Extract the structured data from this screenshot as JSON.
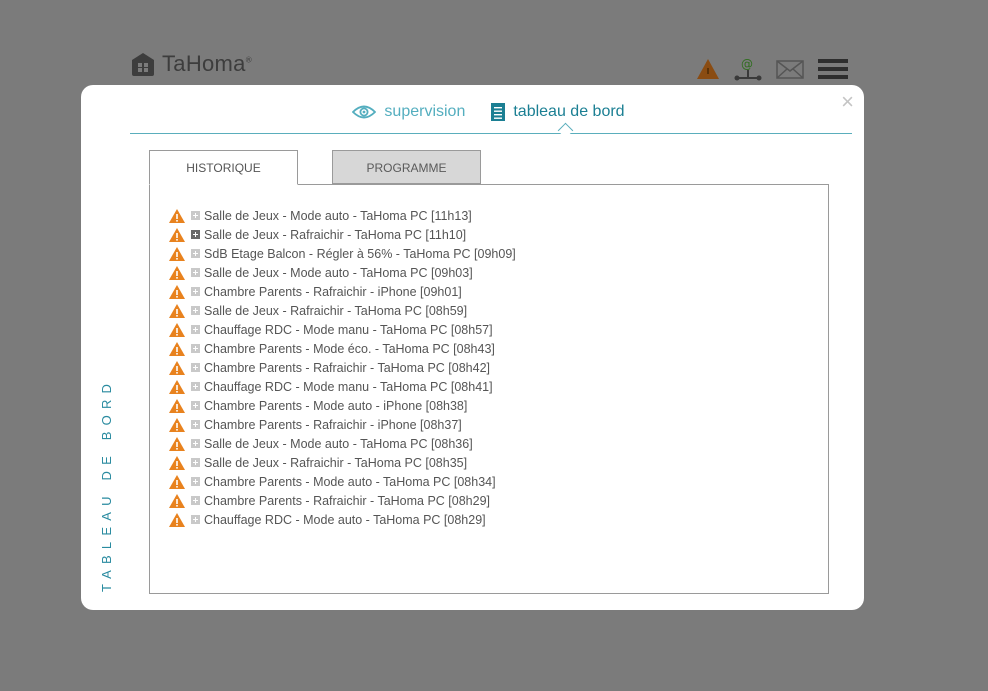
{
  "header": {
    "logo_text": "TaHoma",
    "logo_mark": "®",
    "icons": [
      "warning-icon",
      "network-icon",
      "mail-icon",
      "menu-icon"
    ]
  },
  "modal": {
    "close_label": "×",
    "nav": {
      "supervision": "supervision",
      "dashboard": "tableau de bord"
    },
    "side_label": "TABLEAU DE BORD",
    "tabs": {
      "history": "HISTORIQUE",
      "program": "PROGRAMME"
    },
    "history": [
      {
        "text": "Salle de Jeux - Mode auto - TaHoma PC  [11h13]"
      },
      {
        "text": "Salle de Jeux - Rafraichir - TaHoma PC  [11h10]"
      },
      {
        "text": "SdB Etage Balcon - Régler à 56% - TaHoma PC  [09h09]"
      },
      {
        "text": "Salle de Jeux - Mode auto - TaHoma PC  [09h03]"
      },
      {
        "text": "Chambre Parents - Rafraichir - iPhone  [09h01]"
      },
      {
        "text": "Salle de Jeux - Rafraichir - TaHoma PC  [08h59]"
      },
      {
        "text": "Chauffage RDC - Mode manu - TaHoma PC  [08h57]"
      },
      {
        "text": "Chambre Parents - Mode éco. - TaHoma PC  [08h43]"
      },
      {
        "text": "Chambre Parents - Rafraichir - TaHoma PC  [08h42]"
      },
      {
        "text": "Chauffage RDC - Mode manu - TaHoma PC  [08h41]"
      },
      {
        "text": "Chambre Parents - Mode auto - iPhone  [08h38]"
      },
      {
        "text": "Chambre Parents - Rafraichir - iPhone  [08h37]"
      },
      {
        "text": "Salle de Jeux - Mode auto - TaHoma PC  [08h36]"
      },
      {
        "text": "Salle de Jeux - Rafraichir - TaHoma PC  [08h35]"
      },
      {
        "text": "Chambre Parents - Mode auto - TaHoma PC  [08h34]"
      },
      {
        "text": "Chambre Parents - Rafraichir - TaHoma PC  [08h29]"
      },
      {
        "text": "Chauffage RDC - Mode auto - TaHoma PC  [08h29]"
      }
    ]
  },
  "colors": {
    "accent": "#1b7f93",
    "warning": "#e8821e",
    "overlay": "#7b7b7b"
  }
}
